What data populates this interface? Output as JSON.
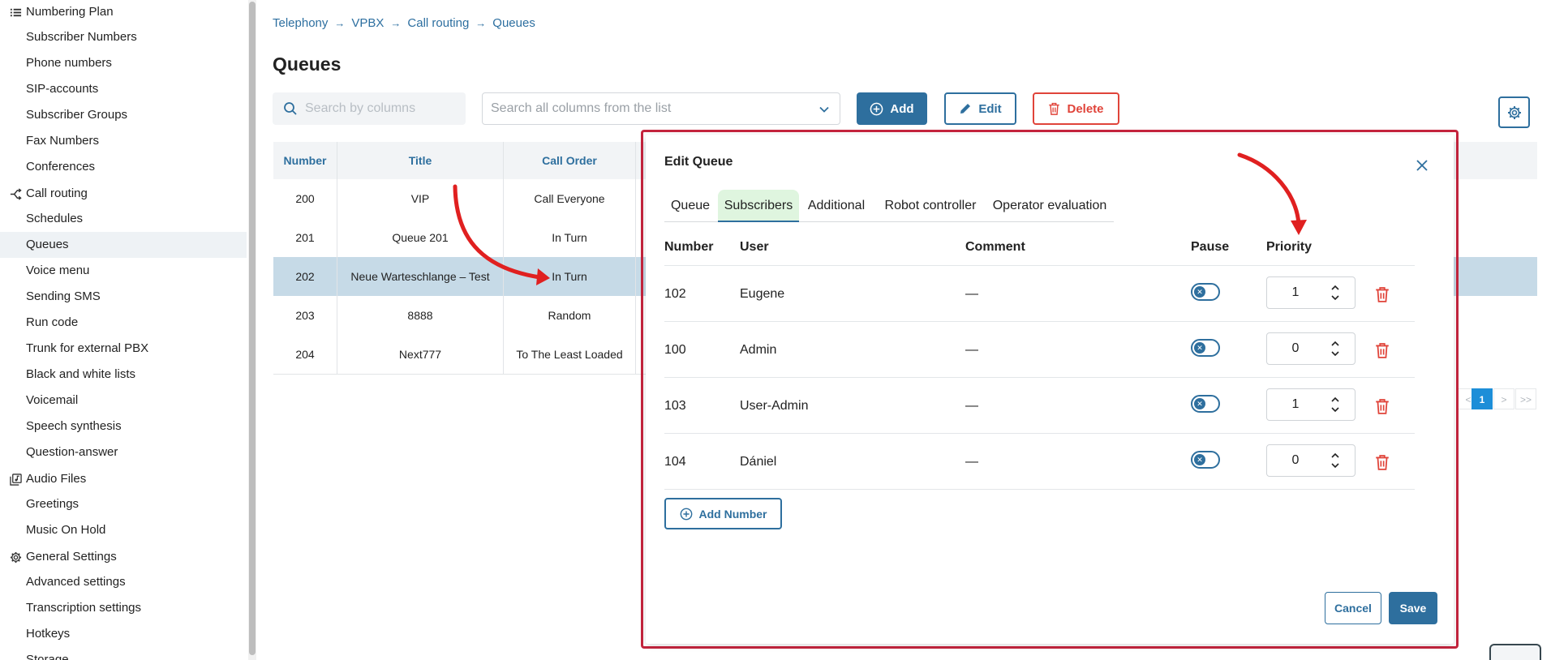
{
  "sidebar": {
    "items": [
      {
        "label": "Numbering Plan",
        "type": "section",
        "icon": "list-icon"
      },
      {
        "label": "Subscriber Numbers",
        "type": "sub"
      },
      {
        "label": "Phone numbers",
        "type": "sub"
      },
      {
        "label": "SIP-accounts",
        "type": "sub"
      },
      {
        "label": "Subscriber Groups",
        "type": "sub"
      },
      {
        "label": "Fax Numbers",
        "type": "sub"
      },
      {
        "label": "Conferences",
        "type": "sub"
      },
      {
        "label": "Call routing",
        "type": "section",
        "icon": "routing-icon"
      },
      {
        "label": "Schedules",
        "type": "sub"
      },
      {
        "label": "Queues",
        "type": "sub",
        "active": true
      },
      {
        "label": "Voice menu",
        "type": "sub"
      },
      {
        "label": "Sending SMS",
        "type": "sub"
      },
      {
        "label": "Run code",
        "type": "sub"
      },
      {
        "label": "Trunk for external PBX",
        "type": "sub"
      },
      {
        "label": "Black and white lists",
        "type": "sub"
      },
      {
        "label": "Voicemail",
        "type": "sub"
      },
      {
        "label": "Speech synthesis",
        "type": "sub"
      },
      {
        "label": "Question-answer",
        "type": "sub"
      },
      {
        "label": "Audio Files",
        "type": "section",
        "icon": "audio-files-icon"
      },
      {
        "label": "Greetings",
        "type": "sub"
      },
      {
        "label": "Music On Hold",
        "type": "sub"
      },
      {
        "label": "General Settings",
        "type": "section",
        "icon": "gear-icon"
      },
      {
        "label": "Advanced settings",
        "type": "sub"
      },
      {
        "label": "Transcription settings",
        "type": "sub"
      },
      {
        "label": "Hotkeys",
        "type": "sub"
      },
      {
        "label": "Storage",
        "type": "sub"
      }
    ]
  },
  "breadcrumb": [
    "Telephony",
    "VPBX",
    "Call routing",
    "Queues"
  ],
  "page": {
    "title": "Queues"
  },
  "toolbar": {
    "search_placeholder": "Search by columns",
    "select_placeholder": "Search all columns from the list",
    "add_label": "Add",
    "edit_label": "Edit",
    "delete_label": "Delete"
  },
  "table": {
    "columns": [
      "Number",
      "Title",
      "Call Order"
    ],
    "rows": [
      {
        "number": "200",
        "title": "VIP",
        "order": "Call Everyone"
      },
      {
        "number": "201",
        "title": "Queue 201",
        "order": "In Turn"
      },
      {
        "number": "202",
        "title": "Neue Warteschlange – Test",
        "order": "In Turn",
        "selected": true
      },
      {
        "number": "203",
        "title": "8888",
        "order": "Random"
      },
      {
        "number": "204",
        "title": "Next777",
        "order": "To The Least Loaded"
      }
    ]
  },
  "pagination": {
    "prev": "<",
    "current": "1",
    "next": ">",
    "last": ">>"
  },
  "modal": {
    "title": "Edit Queue",
    "tabs": [
      {
        "label": "Queue"
      },
      {
        "label": "Subscribers",
        "active": true
      },
      {
        "label": "Additional"
      },
      {
        "label": "Robot controller"
      },
      {
        "label": "Operator evaluation"
      }
    ],
    "columns": {
      "number": "Number",
      "user": "User",
      "comment": "Comment",
      "pause": "Pause",
      "priority": "Priority"
    },
    "rows": [
      {
        "number": "102",
        "user": "Eugene",
        "comment": "—",
        "pause": false,
        "priority": "1"
      },
      {
        "number": "100",
        "user": "Admin",
        "comment": "—",
        "pause": false,
        "priority": "0"
      },
      {
        "number": "103",
        "user": "User-Admin",
        "comment": "—",
        "pause": false,
        "priority": "1"
      },
      {
        "number": "104",
        "user": "Dániel",
        "comment": "—",
        "pause": false,
        "priority": "0"
      }
    ],
    "add_number_label": "Add Number",
    "cancel_label": "Cancel",
    "save_label": "Save"
  },
  "colors": {
    "accent": "#2e6f9e",
    "danger": "#e0443a",
    "selected_row": "#c6dae7",
    "active_tab": "#dff5df",
    "highlight_frame": "#c4243d",
    "annotation_arrow": "#e02020"
  }
}
